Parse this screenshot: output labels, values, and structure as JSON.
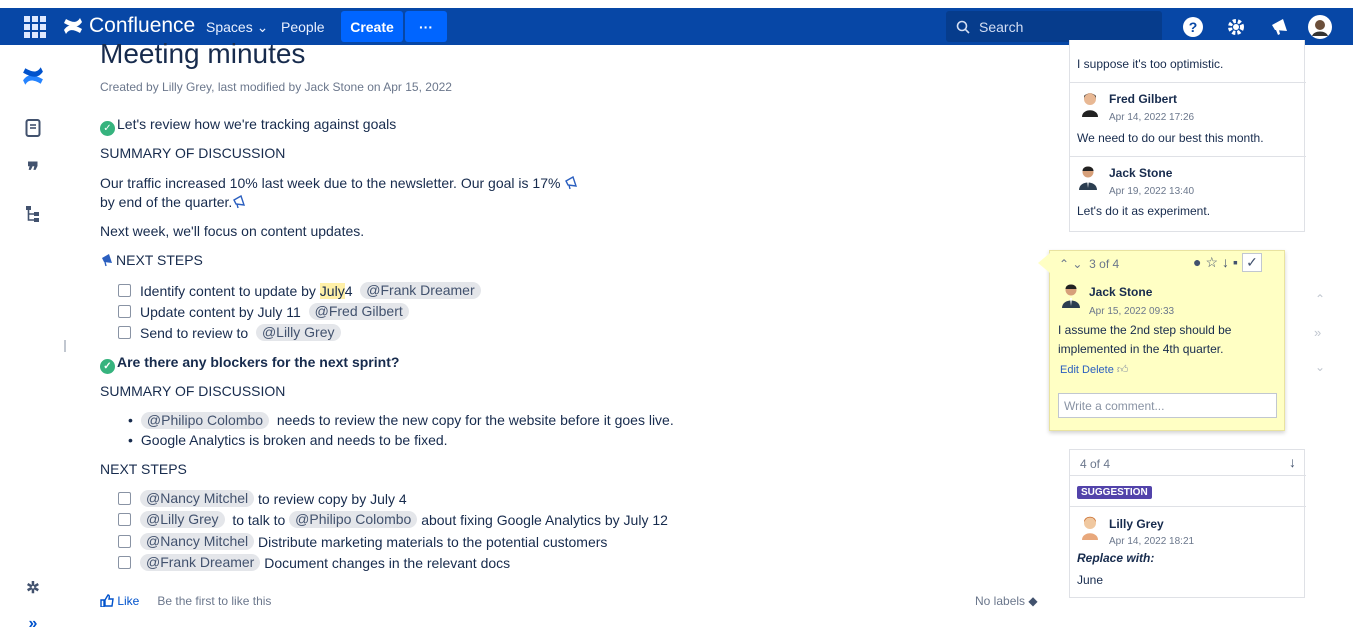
{
  "nav": {
    "brand": "Confluence",
    "spaces": "Spaces",
    "people": "People",
    "create": "Create",
    "more": "···",
    "search_placeholder": "Search"
  },
  "page": {
    "title": "Meeting minutes",
    "meta": "Created by Lilly Grey, last modified by Jack Stone on Apr 15, 2022",
    "goal_line": "Let's review how we're tracking against goals",
    "summary1": "SUMMARY OF DISCUSSION",
    "traffic1": "Our traffic increased 10% last week due to the newsletter. Our goal is 17%",
    "traffic2": "by end of the quarter.",
    "next_week": "Next week, we'll focus on content updates.",
    "next_steps1": "NEXT STEPS",
    "task1_a": "Identify content to update by",
    "task1_hl": "July",
    "task1_b": " 4",
    "task1_mention": "@Frank Dreamer",
    "task2": "Update content by July 11",
    "task2_mention": "@Fred Gilbert",
    "task3": "Send to review to",
    "task3_mention": "@Lilly Grey",
    "blockers": "Are there any blockers for the next sprint?",
    "summary2": "SUMMARY OF DISCUSSION",
    "bullet1_mention": "@Philipo Colombo",
    "bullet1": "needs to review the new copy for the website before it goes live.",
    "bullet2": "Google Analytics is broken and needs to be fixed.",
    "next_steps2": "NEXT STEPS",
    "t4_mention": "@Nancy Mitchel",
    "t4": "to review copy by July 4",
    "t5_mention": "@Lilly Grey",
    "t5_a": "to talk to",
    "t5_mention2": "@Philipo Colombo",
    "t5_b": "about fixing Google Analytics by July 12",
    "t6_mention": "@Nancy Mitchel",
    "t6": "Distribute marketing materials to the potential customers",
    "t7_mention": "@Frank Dreamer",
    "t7": "Document changes in the relevant docs",
    "like": "Like",
    "first_like": "Be the first to like this",
    "no_labels": "No labels"
  },
  "comments": {
    "top_text": "I suppose it's too optimistic.",
    "c1": {
      "name": "Fred Gilbert",
      "date": "Apr 14, 2022 17:26",
      "text": "We need to do our best this month."
    },
    "c2": {
      "name": "Jack Stone",
      "date": "Apr 19, 2022 13:40",
      "text": "Let's do it as experiment."
    },
    "active": {
      "counter": "3 of 4",
      "name": "Jack Stone",
      "date": "Apr 15, 2022 09:33",
      "text": "I assume the 2nd step should be implemented in the 4th quarter.",
      "edit": "Edit",
      "delete": "Delete",
      "placeholder": "Write a comment..."
    },
    "suggest": {
      "counter": "4 of 4",
      "badge": "SUGGESTION",
      "name": "Lilly Grey",
      "date": "Apr 14, 2022 18:21",
      "replace": "Replace with:",
      "value": "June"
    }
  }
}
